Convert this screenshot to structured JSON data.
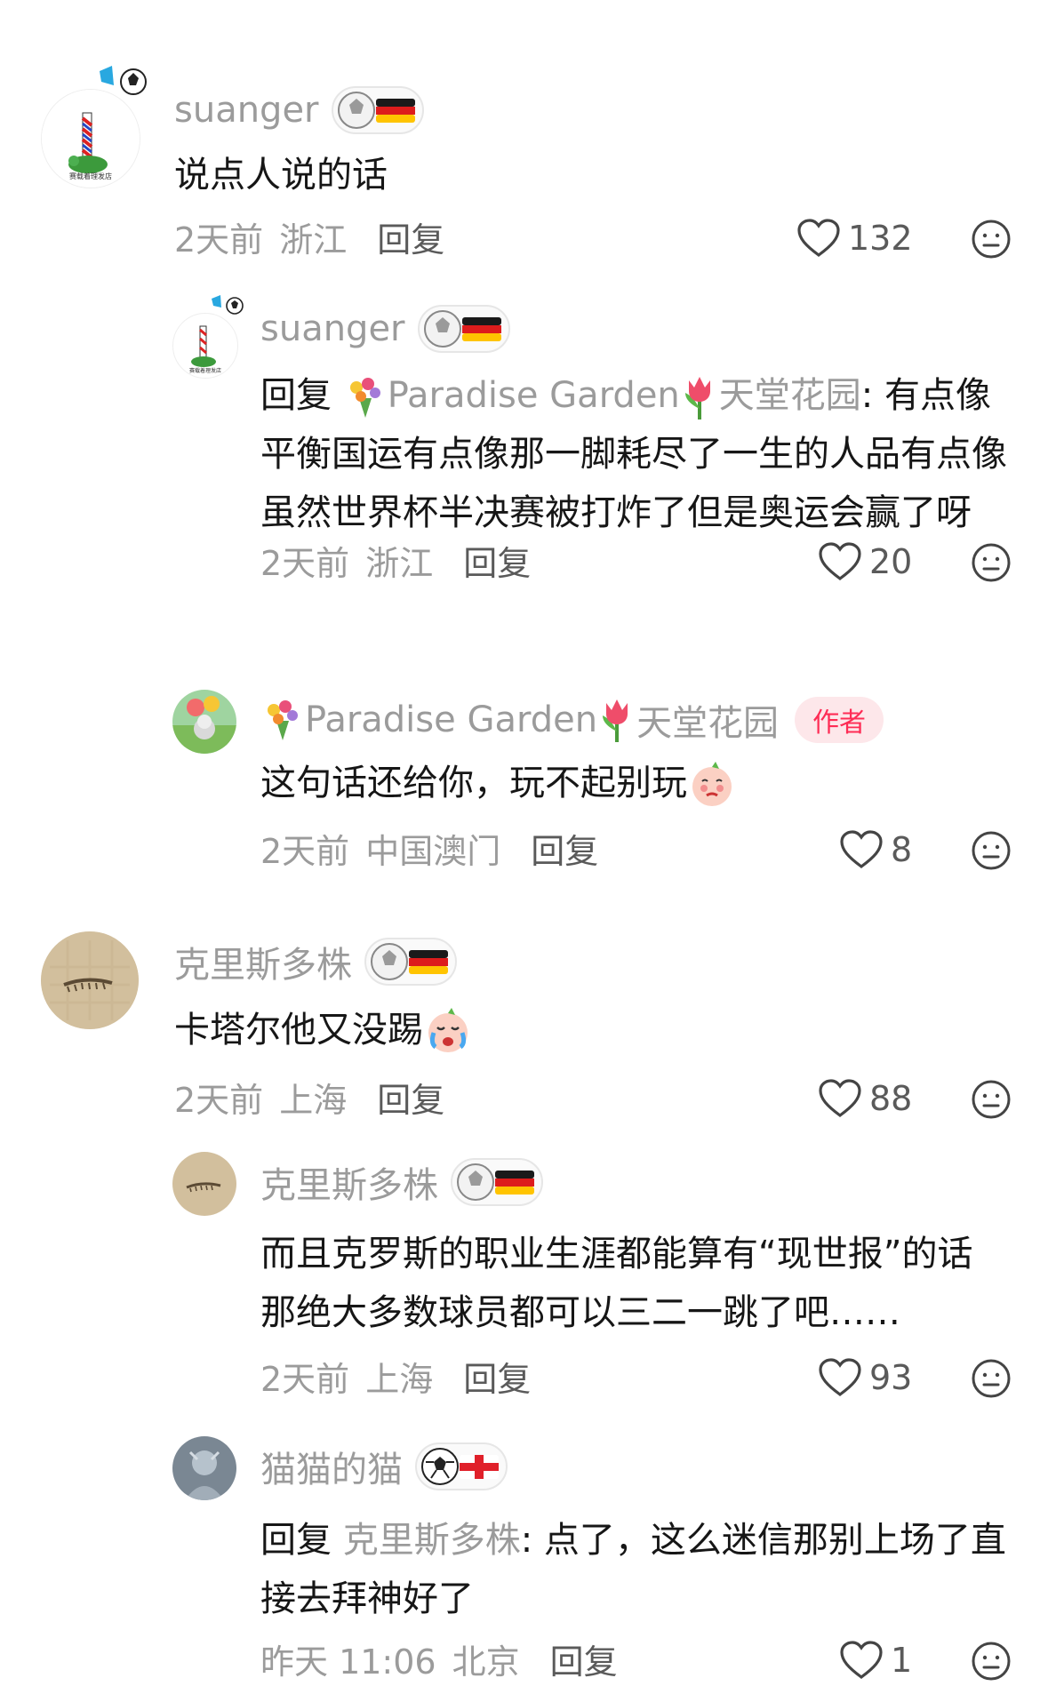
{
  "comments": [
    {
      "user": "suanger",
      "text": "说点人说的话",
      "time": "2天前",
      "location": "浙江",
      "reply_label": "回复",
      "likes": "132",
      "replies": [
        {
          "user": "suanger",
          "reply_prefix": "回复",
          "mention": "Paradise Garden",
          "mention_suffix": "天堂花园",
          "text_after_mention": ": 有点像平衡国运有点像那一脚耗尽了一生的人品有点像虽然世界杯半决赛被打炸了但是奥运会赢了呀",
          "time": "2天前",
          "location": "浙江",
          "reply_label": "回复",
          "likes": "20"
        },
        {
          "user": "Paradise Garden",
          "user_suffix": "天堂花园",
          "author_tag": "作者",
          "text": "这句话还给你，玩不起别玩",
          "time": "2天前",
          "location": "中国澳门",
          "reply_label": "回复",
          "likes": "8"
        }
      ]
    },
    {
      "user": "克里斯多株",
      "text": "卡塔尔他又没踢",
      "time": "2天前",
      "location": "上海",
      "reply_label": "回复",
      "likes": "88",
      "replies": [
        {
          "user": "克里斯多株",
          "text": "而且克罗斯的职业生涯都能算有“现世报”的话那绝大多数球员都可以三二一跳了吧……",
          "time": "2天前",
          "location": "上海",
          "reply_label": "回复",
          "likes": "93"
        },
        {
          "user": "猫猫的猫",
          "reply_prefix": "回复",
          "mention": "克里斯多株",
          "text_after_mention": ": 点了，这么迷信那别上场了直接去拜神好了",
          "time": "昨天 11:06",
          "location": "北京",
          "reply_label": "回复",
          "likes": "1"
        }
      ]
    }
  ],
  "icons": {
    "like": "heart-outline-icon",
    "more": "emoji-neutral-icon",
    "badge_germany": "football-germany-badge",
    "badge_england": "football-england-badge"
  },
  "colors": {
    "username": "#9b9b9b",
    "text": "#161616",
    "author_tag_bg": "#fde7ea",
    "author_tag_fg": "#fe2c55"
  }
}
